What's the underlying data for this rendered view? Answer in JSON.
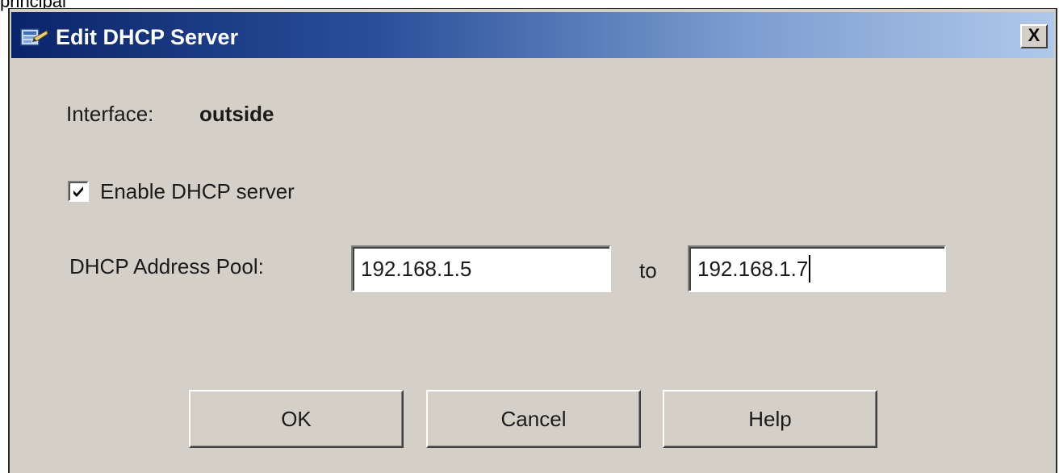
{
  "background": {
    "caption": "principal"
  },
  "window": {
    "title": "Edit DHCP Server",
    "close_label": "X",
    "app_icon": "dhcp-server-icon"
  },
  "form": {
    "interface_label": "Interface:",
    "interface_value": "outside",
    "enable_label": "Enable DHCP server",
    "enable_checked": true,
    "pool_label": "DHCP Address Pool:",
    "pool_start": "192.168.1.5",
    "pool_separator": "to",
    "pool_end": "192.168.1.7"
  },
  "buttons": {
    "ok": "OK",
    "cancel": "Cancel",
    "help": "Help"
  },
  "colors": {
    "titlebar_start": "#0a246a",
    "titlebar_end": "#b0c8ea",
    "dialog_face": "#d4d0c8"
  }
}
